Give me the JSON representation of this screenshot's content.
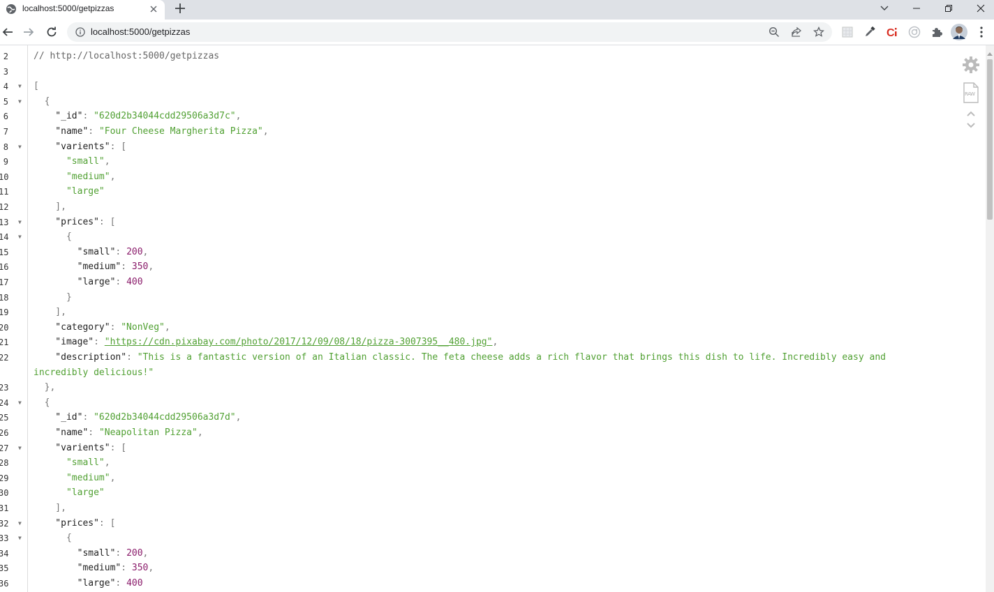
{
  "window": {
    "tab_title": "localhost:5000/getpizzas",
    "controls": [
      "chevron-down",
      "minimize",
      "restore",
      "close"
    ]
  },
  "toolbar": {
    "url": "localhost:5000/getpizzas",
    "extensions": [
      "extension-grid-icon",
      "eyedropper-icon",
      "c-extension-icon",
      "circle-extension-icon",
      "puzzle-icon",
      "avatar"
    ]
  },
  "colors": {
    "string": "#50a032",
    "number": "#8a1b6a",
    "key": "#222222",
    "comment": "#666666"
  },
  "code": {
    "lines": [
      {
        "n": "2",
        "fold": false,
        "tokens": [
          [
            "comment",
            "// http://localhost:5000/getpizzas"
          ]
        ]
      },
      {
        "n": "3",
        "fold": false,
        "tokens": []
      },
      {
        "n": "4",
        "fold": true,
        "tokens": [
          [
            "punc",
            "["
          ]
        ]
      },
      {
        "n": "5",
        "fold": true,
        "tokens": [
          [
            "punc",
            "  {"
          ]
        ]
      },
      {
        "n": "6",
        "fold": false,
        "tokens": [
          [
            "key",
            "    \"_id\""
          ],
          [
            "punc",
            ": "
          ],
          [
            "str",
            "\"620d2b34044cdd29506a3d7c\""
          ],
          [
            "punc",
            ","
          ]
        ]
      },
      {
        "n": "7",
        "fold": false,
        "tokens": [
          [
            "key",
            "    \"name\""
          ],
          [
            "punc",
            ": "
          ],
          [
            "str",
            "\"Four Cheese Margherita Pizza\""
          ],
          [
            "punc",
            ","
          ]
        ]
      },
      {
        "n": "8",
        "fold": true,
        "tokens": [
          [
            "key",
            "    \"varients\""
          ],
          [
            "punc",
            ": ["
          ]
        ]
      },
      {
        "n": "9",
        "fold": false,
        "tokens": [
          [
            "str",
            "      \"small\""
          ],
          [
            "punc",
            ","
          ]
        ]
      },
      {
        "n": "10",
        "fold": false,
        "tokens": [
          [
            "str",
            "      \"medium\""
          ],
          [
            "punc",
            ","
          ]
        ]
      },
      {
        "n": "11",
        "fold": false,
        "tokens": [
          [
            "str",
            "      \"large\""
          ]
        ]
      },
      {
        "n": "12",
        "fold": false,
        "tokens": [
          [
            "punc",
            "    ],"
          ]
        ]
      },
      {
        "n": "13",
        "fold": true,
        "tokens": [
          [
            "key",
            "    \"prices\""
          ],
          [
            "punc",
            ": ["
          ]
        ]
      },
      {
        "n": "14",
        "fold": true,
        "tokens": [
          [
            "punc",
            "      {"
          ]
        ]
      },
      {
        "n": "15",
        "fold": false,
        "tokens": [
          [
            "key",
            "        \"small\""
          ],
          [
            "punc",
            ": "
          ],
          [
            "num",
            "200"
          ],
          [
            "punc",
            ","
          ]
        ]
      },
      {
        "n": "16",
        "fold": false,
        "tokens": [
          [
            "key",
            "        \"medium\""
          ],
          [
            "punc",
            ": "
          ],
          [
            "num",
            "350"
          ],
          [
            "punc",
            ","
          ]
        ]
      },
      {
        "n": "17",
        "fold": false,
        "tokens": [
          [
            "key",
            "        \"large\""
          ],
          [
            "punc",
            ": "
          ],
          [
            "num",
            "400"
          ]
        ]
      },
      {
        "n": "18",
        "fold": false,
        "tokens": [
          [
            "punc",
            "      }"
          ]
        ]
      },
      {
        "n": "19",
        "fold": false,
        "tokens": [
          [
            "punc",
            "    ],"
          ]
        ]
      },
      {
        "n": "20",
        "fold": false,
        "tokens": [
          [
            "key",
            "    \"category\""
          ],
          [
            "punc",
            ": "
          ],
          [
            "str",
            "\"NonVeg\""
          ],
          [
            "punc",
            ","
          ]
        ]
      },
      {
        "n": "21",
        "fold": false,
        "tokens": [
          [
            "key",
            "    \"image\""
          ],
          [
            "punc",
            ": "
          ],
          [
            "link",
            "\"https://cdn.pixabay.com/photo/2017/12/09/08/18/pizza-3007395__480.jpg\""
          ],
          [
            "punc",
            ","
          ]
        ]
      },
      {
        "n": "22",
        "fold": false,
        "tokens": [
          [
            "key",
            "    \"description\""
          ],
          [
            "punc",
            ": "
          ],
          [
            "str",
            "\"This is a fantastic version of an Italian classic. The feta cheese adds a rich flavor that brings this dish to life. Incredibly easy and"
          ]
        ]
      },
      {
        "n": "",
        "fold": false,
        "tokens": [
          [
            "str",
            "incredibly delicious!\""
          ]
        ]
      },
      {
        "n": "23",
        "fold": false,
        "tokens": [
          [
            "punc",
            "  },"
          ]
        ]
      },
      {
        "n": "24",
        "fold": true,
        "tokens": [
          [
            "punc",
            "  {"
          ]
        ]
      },
      {
        "n": "25",
        "fold": false,
        "tokens": [
          [
            "key",
            "    \"_id\""
          ],
          [
            "punc",
            ": "
          ],
          [
            "str",
            "\"620d2b34044cdd29506a3d7d\""
          ],
          [
            "punc",
            ","
          ]
        ]
      },
      {
        "n": "26",
        "fold": false,
        "tokens": [
          [
            "key",
            "    \"name\""
          ],
          [
            "punc",
            ": "
          ],
          [
            "str",
            "\"Neapolitan Pizza\""
          ],
          [
            "punc",
            ","
          ]
        ]
      },
      {
        "n": "27",
        "fold": true,
        "tokens": [
          [
            "key",
            "    \"varients\""
          ],
          [
            "punc",
            ": ["
          ]
        ]
      },
      {
        "n": "28",
        "fold": false,
        "tokens": [
          [
            "str",
            "      \"small\""
          ],
          [
            "punc",
            ","
          ]
        ]
      },
      {
        "n": "29",
        "fold": false,
        "tokens": [
          [
            "str",
            "      \"medium\""
          ],
          [
            "punc",
            ","
          ]
        ]
      },
      {
        "n": "30",
        "fold": false,
        "tokens": [
          [
            "str",
            "      \"large\""
          ]
        ]
      },
      {
        "n": "31",
        "fold": false,
        "tokens": [
          [
            "punc",
            "    ],"
          ]
        ]
      },
      {
        "n": "32",
        "fold": true,
        "tokens": [
          [
            "key",
            "    \"prices\""
          ],
          [
            "punc",
            ": ["
          ]
        ]
      },
      {
        "n": "33",
        "fold": true,
        "tokens": [
          [
            "punc",
            "      {"
          ]
        ]
      },
      {
        "n": "34",
        "fold": false,
        "tokens": [
          [
            "key",
            "        \"small\""
          ],
          [
            "punc",
            ": "
          ],
          [
            "num",
            "200"
          ],
          [
            "punc",
            ","
          ]
        ]
      },
      {
        "n": "35",
        "fold": false,
        "tokens": [
          [
            "key",
            "        \"medium\""
          ],
          [
            "punc",
            ": "
          ],
          [
            "num",
            "350"
          ],
          [
            "punc",
            ","
          ]
        ]
      },
      {
        "n": "36",
        "fold": false,
        "tokens": [
          [
            "key",
            "        \"large\""
          ],
          [
            "punc",
            ": "
          ],
          [
            "num",
            "400"
          ]
        ]
      }
    ]
  },
  "tools": {
    "raw_label": "RAW"
  }
}
